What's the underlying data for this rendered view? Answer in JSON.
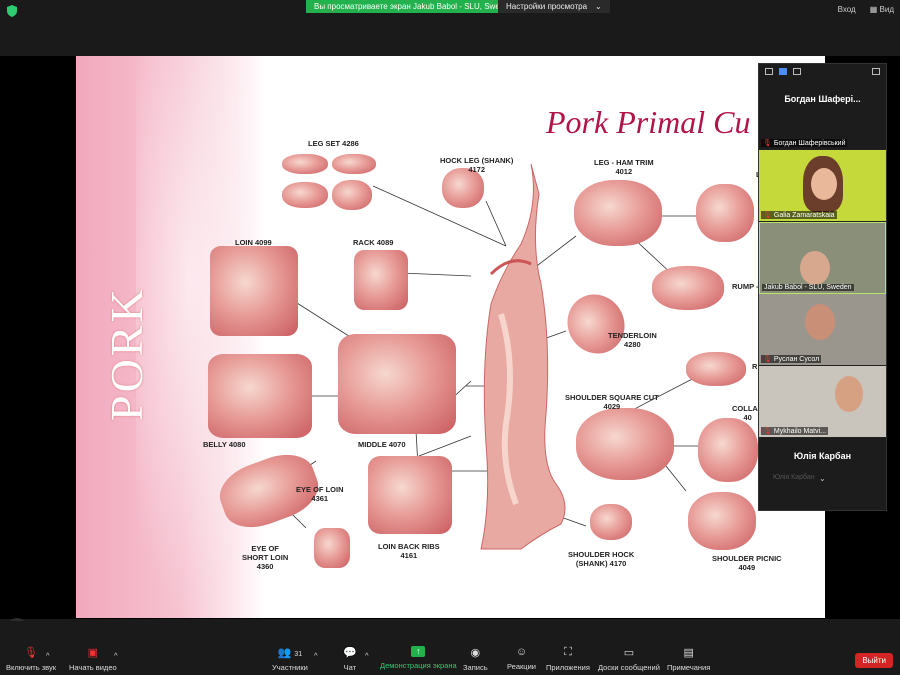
{
  "topbar": {
    "share_banner": "Вы просматриваете экран Jakub Babol - SLU, Sweden",
    "view_options": "Настройки просмотра",
    "sign_in": "Вход",
    "view": "Вид"
  },
  "slide": {
    "title": "Pork Primal Cu",
    "side_text": "PORK",
    "labels": {
      "leg_set": "LEG SET 4286",
      "hock_leg": "HOCK LEG (SHANK)\n4172",
      "leg_ham_trim": "LEG - HAM TRIM\n4012",
      "loin": "LOIN 4099",
      "rack": "RACK 4089",
      "rump": "RUMP -",
      "tenderloin": "TENDERLOIN\n4280",
      "belly": "BELLY 4080",
      "middle": "MIDDLE 4070",
      "shoulder_square": "SHOULDER SQUARE CUT\n4029",
      "collar": "COLLAR\n40",
      "eye_of_loin": "EYE OF LOIN\n4361",
      "eye_short_loin": "EYE OF\nSHORT LOIN\n4360",
      "loin_back_ribs": "LOIN BACK RIBS\n4161",
      "shoulder_hock": "SHOULDER HOCK\n(SHANK) 4170",
      "shoulder_picnic": "SHOULDER PICNIC\n4049",
      "r_partial": "R",
      "l_partial": "L"
    }
  },
  "participants": {
    "active_speaker": "Богдан Шафері...",
    "tiles": [
      {
        "name": "Богдан Шаферівський"
      },
      {
        "name": "Galia Zamaratskaia"
      },
      {
        "name": "Jakub Babol - SLU, Sweden"
      },
      {
        "name": "Руслан Сусол"
      },
      {
        "name": "Mykhailo Matvi..."
      }
    ],
    "bottom_name": "Юлія Карбан",
    "partial_name": "Юлія Карбан"
  },
  "toolbar": {
    "unmute": "Включить звук",
    "start_video": "Начать видео",
    "participants": "Участники",
    "participants_count": "31",
    "chat": "Чат",
    "share_screen": "Демонстрация экрана",
    "record": "Запись",
    "reactions": "Реакции",
    "apps": "Приложения",
    "whiteboards": "Доски сообщений",
    "notes": "Примечания",
    "leave": "Выйти"
  },
  "colors": {
    "accent_green": "#22b14c",
    "leave_red": "#d42424",
    "title_crimson": "#b0144a",
    "pink_band": "#f2a8bd"
  }
}
